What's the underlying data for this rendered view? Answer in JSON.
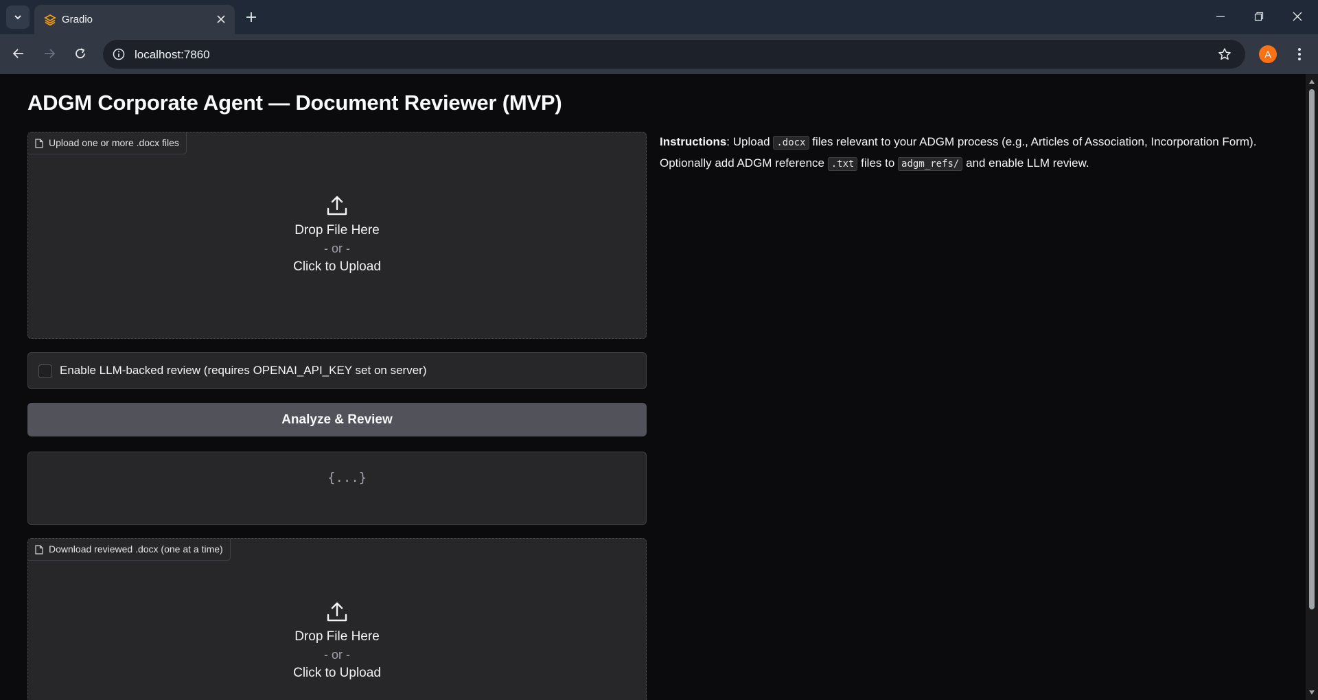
{
  "browser": {
    "tab_title": "Gradio",
    "url": "localhost:7860",
    "profile_initial": "A"
  },
  "page": {
    "title": "ADGM Corporate Agent — Document Reviewer (MVP)"
  },
  "upload": {
    "label": "Upload one or more .docx files",
    "drop_text": "Drop File Here",
    "or_text": "- or -",
    "click_text": "Click to Upload"
  },
  "llm_checkbox": {
    "label": "Enable LLM-backed review (requires OPENAI_API_KEY set on server)",
    "checked": false
  },
  "analyze_button": {
    "label": "Analyze & Review"
  },
  "json_output": {
    "placeholder_icon": "{...}"
  },
  "download": {
    "label": "Download reviewed .docx (one at a time)",
    "drop_text": "Drop File Here",
    "or_text": "- or -",
    "click_text": "Click to Upload"
  },
  "instructions": {
    "heading": "Instructions",
    "part1": ": Upload ",
    "code1": ".docx",
    "part2": " files relevant to your ADGM process (e.g., Articles of Association, Incorporation Form). Optionally add ADGM reference ",
    "code2": ".txt",
    "part3": " files to ",
    "code3": "adgm_refs/",
    "part4": " and enable LLM review."
  },
  "colors": {
    "accent_button": "#52525b",
    "profile_avatar": "#f97316",
    "page_background": "#0b0b0d",
    "panel_background": "#27272a"
  },
  "icons": [
    "tab-list-icon",
    "gradio-favicon-icon",
    "close-icon",
    "plus-icon",
    "minimize-icon",
    "restore-icon",
    "window-close-icon",
    "back-arrow-icon",
    "forward-arrow-icon",
    "reload-icon",
    "site-info-icon",
    "bookmark-star-icon",
    "more-vert-icon",
    "file-icon",
    "upload-icon"
  ]
}
